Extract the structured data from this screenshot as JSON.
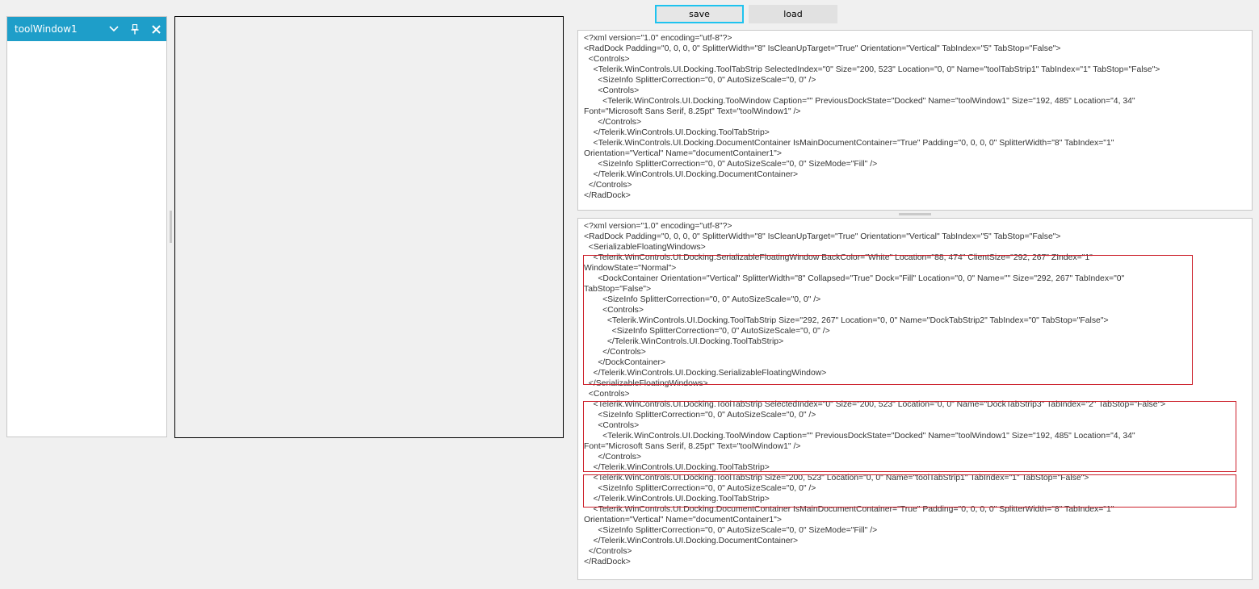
{
  "tool_window": {
    "title": "toolWindow1",
    "buttons": [
      {
        "name": "dropdown",
        "icon": "chevron-down-icon"
      },
      {
        "name": "pin",
        "icon": "pin-icon"
      },
      {
        "name": "close",
        "icon": "close-icon"
      }
    ]
  },
  "toolbar": {
    "save_label": "save",
    "load_label": "load"
  },
  "colors": {
    "tool_header": "#1e9ec9",
    "highlight": "#cc1f2a",
    "save_border": "#1ec3ef"
  },
  "xml_top": {
    "lines": [
      "<?xml version=\"1.0\" encoding=\"utf-8\"?>",
      "<RadDock Padding=\"0, 0, 0, 0\" SplitterWidth=\"8\" IsCleanUpTarget=\"True\" Orientation=\"Vertical\" TabIndex=\"5\" TabStop=\"False\">",
      "  <Controls>",
      "    <Telerik.WinControls.UI.Docking.ToolTabStrip SelectedIndex=\"0\" Size=\"200, 523\" Location=\"0, 0\" Name=\"toolTabStrip1\" TabIndex=\"1\" TabStop=\"False\">",
      "      <SizeInfo SplitterCorrection=\"0, 0\" AutoSizeScale=\"0, 0\" />",
      "      <Controls>",
      "        <Telerik.WinControls.UI.Docking.ToolWindow Caption=\"\" PreviousDockState=\"Docked\" Name=\"toolWindow1\" Size=\"192, 485\" Location=\"4, 34\"",
      "Font=\"Microsoft Sans Serif, 8.25pt\" Text=\"toolWindow1\" />",
      "      </Controls>",
      "    </Telerik.WinControls.UI.Docking.ToolTabStrip>",
      "    <Telerik.WinControls.UI.Docking.DocumentContainer IsMainDocumentContainer=\"True\" Padding=\"0, 0, 0, 0\" SplitterWidth=\"8\" TabIndex=\"1\"",
      "Orientation=\"Vertical\" Name=\"documentContainer1\">",
      "      <SizeInfo SplitterCorrection=\"0, 0\" AutoSizeScale=\"0, 0\" SizeMode=\"Fill\" />",
      "    </Telerik.WinControls.UI.Docking.DocumentContainer>",
      "  </Controls>",
      "</RadDock>"
    ]
  },
  "xml_bottom": {
    "lines": [
      "<?xml version=\"1.0\" encoding=\"utf-8\"?>",
      "<RadDock Padding=\"0, 0, 0, 0\" SplitterWidth=\"8\" IsCleanUpTarget=\"True\" Orientation=\"Vertical\" TabIndex=\"5\" TabStop=\"False\">",
      "  <SerializableFloatingWindows>",
      "    <Telerik.WinControls.UI.Docking.SerializableFloatingWindow BackColor=\"White\" Location=\"88, 474\" ClientSize=\"292, 267\" ZIndex=\"1\"",
      "WindowState=\"Normal\">",
      "      <DockContainer Orientation=\"Vertical\" SplitterWidth=\"8\" Collapsed=\"True\" Dock=\"Fill\" Location=\"0, 0\" Name=\"\" Size=\"292, 267\" TabIndex=\"0\"",
      "TabStop=\"False\">",
      "        <SizeInfo SplitterCorrection=\"0, 0\" AutoSizeScale=\"0, 0\" />",
      "        <Controls>",
      "          <Telerik.WinControls.UI.Docking.ToolTabStrip Size=\"292, 267\" Location=\"0, 0\" Name=\"DockTabStrip2\" TabIndex=\"0\" TabStop=\"False\">",
      "            <SizeInfo SplitterCorrection=\"0, 0\" AutoSizeScale=\"0, 0\" />",
      "          </Telerik.WinControls.UI.Docking.ToolTabStrip>",
      "        </Controls>",
      "      </DockContainer>",
      "    </Telerik.WinControls.UI.Docking.SerializableFloatingWindow>",
      "  </SerializableFloatingWindows>",
      "  <Controls>",
      "    <Telerik.WinControls.UI.Docking.ToolTabStrip SelectedIndex=\"0\" Size=\"200, 523\" Location=\"0, 0\" Name=\"DockTabStrip3\" TabIndex=\"2\" TabStop=\"False\">",
      "      <SizeInfo SplitterCorrection=\"0, 0\" AutoSizeScale=\"0, 0\" />",
      "      <Controls>",
      "        <Telerik.WinControls.UI.Docking.ToolWindow Caption=\"\" PreviousDockState=\"Docked\" Name=\"toolWindow1\" Size=\"192, 485\" Location=\"4, 34\"",
      "Font=\"Microsoft Sans Serif, 8.25pt\" Text=\"toolWindow1\" />",
      "      </Controls>",
      "    </Telerik.WinControls.UI.Docking.ToolTabStrip>",
      "    <Telerik.WinControls.UI.Docking.ToolTabStrip Size=\"200, 523\" Location=\"0, 0\" Name=\"toolTabStrip1\" TabIndex=\"1\" TabStop=\"False\">",
      "      <SizeInfo SplitterCorrection=\"0, 0\" AutoSizeScale=\"0, 0\" />",
      "    </Telerik.WinControls.UI.Docking.ToolTabStrip>",
      "    <Telerik.WinControls.UI.Docking.DocumentContainer IsMainDocumentContainer=\"True\" Padding=\"0, 0, 0, 0\" SplitterWidth=\"8\" TabIndex=\"1\"",
      "Orientation=\"Vertical\" Name=\"documentContainer1\">",
      "      <SizeInfo SplitterCorrection=\"0, 0\" AutoSizeScale=\"0, 0\" SizeMode=\"Fill\" />",
      "    </Telerik.WinControls.UI.Docking.DocumentContainer>",
      "  </Controls>",
      "</RadDock>"
    ]
  }
}
